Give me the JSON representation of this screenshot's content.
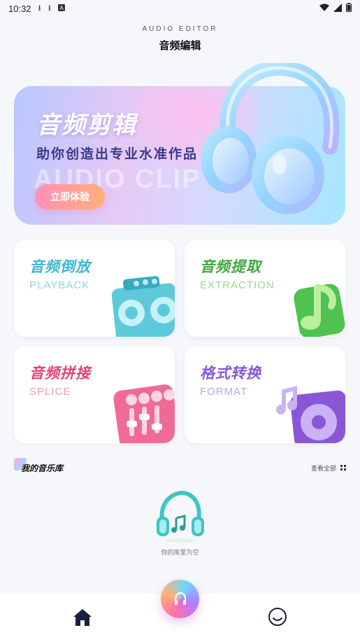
{
  "status_bar": {
    "time": "10:32"
  },
  "header": {
    "subtitle": "AUDIO EDITOR",
    "title": "音频编辑"
  },
  "banner": {
    "title": "音频剪辑",
    "subtitle": "助你创造出专业水准作品",
    "watermark": "AUDIO CLIP",
    "button_label": "立即体验"
  },
  "features": [
    {
      "title": "音频倒放",
      "subtitle": "PLAYBACK",
      "title_color": "#3fb8d0",
      "subtitle_color": "#8fd5e6"
    },
    {
      "title": "音频提取",
      "subtitle": "EXTRACTION",
      "title_color": "#3fa83f",
      "subtitle_color": "#9fd38f"
    },
    {
      "title": "音频拼接",
      "subtitle": "SPLICE",
      "title_color": "#e8407a",
      "subtitle_color": "#f29bb7"
    },
    {
      "title": "格式转换",
      "subtitle": "FORMAT",
      "title_color": "#8a56d6",
      "subtitle_color": "#b9a3e6"
    }
  ],
  "library": {
    "title": "我的音乐库",
    "view_all": "查看全部",
    "empty_text": "你的库里为空"
  },
  "icons": {
    "status": [
      "download-icon",
      "download-icon",
      "a-icon",
      "wifi-icon",
      "signal-icon",
      "battery-icon"
    ],
    "nav": [
      "home-icon",
      "headphone-icon",
      "smiley-icon"
    ]
  }
}
